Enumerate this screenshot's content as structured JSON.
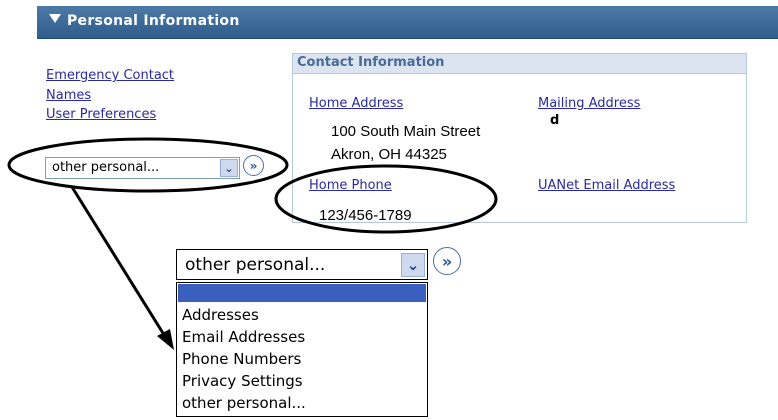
{
  "header": {
    "title": "Personal Information",
    "icon": "triangle-down-icon"
  },
  "left_links": [
    "Emergency Contact",
    "Names",
    "User Preferences"
  ],
  "select_small": {
    "value": "other personal..."
  },
  "contact_panel": {
    "title": "Contact Information",
    "home_address_label": "Home Address",
    "home_address_line1": "100 South Main Street",
    "home_address_line2": "Akron, OH 44325",
    "mailing_address_label": "Mailing Address",
    "mailing_value": "d",
    "home_phone_label": "Home Phone",
    "home_phone_value": "123/456-1789",
    "uanet_email_label": "UANet Email Address"
  },
  "select_large": {
    "value": "other personal..."
  },
  "dropdown_options": [
    "",
    "Addresses",
    "Email Addresses",
    "Phone Numbers",
    "Privacy Settings",
    "other personal..."
  ],
  "colors": {
    "header": "#3b6896",
    "link": "#2a2aa0",
    "highlight": "#3b5fbf"
  }
}
